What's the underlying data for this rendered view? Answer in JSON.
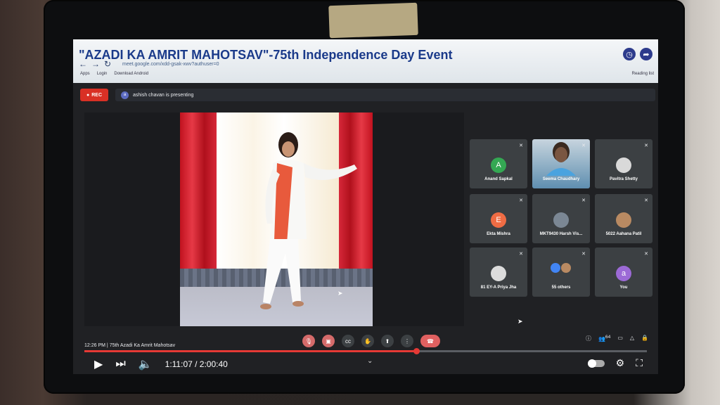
{
  "browser": {
    "tab_title": "\"AZADI KA AMRIT MAHOTSAV\"-75th Independence Day Event",
    "url": "meet.google.com/xdd-gsak-xwv?authuser=0",
    "bookmarks": [
      "Apps",
      "Login",
      "Download Android"
    ],
    "reading_list": "Reading list"
  },
  "meet": {
    "rec_label": "REC",
    "presenter_initial": "a",
    "presenting_text": "ashish chavan is presenting",
    "participants": [
      {
        "name": "Anand Sapkal",
        "initial": "A",
        "color": "#34a853",
        "type": "avatar"
      },
      {
        "name": "Seema Chaudhary",
        "initial": "",
        "color": "#5f8fb0",
        "type": "video"
      },
      {
        "name": "Pavitra Shetty",
        "initial": "",
        "color": "#d9d9d9",
        "type": "photo"
      },
      {
        "name": "Ekta Mishra",
        "initial": "E",
        "color": "#ef6c44",
        "type": "avatar"
      },
      {
        "name": "MKT9430 Harsh Vis...",
        "initial": "",
        "color": "#7b8794",
        "type": "photo"
      },
      {
        "name": "5022 Aahana Patil",
        "initial": "",
        "color": "#b98a62",
        "type": "photo"
      },
      {
        "name": "81 EY-A Priya Jha",
        "initial": "",
        "color": "#dcdcdc",
        "type": "photo"
      },
      {
        "name": "55 others",
        "initial": "",
        "color": "#4285f4",
        "type": "others"
      },
      {
        "name": "You",
        "initial": "a",
        "color": "#9c6ad6",
        "type": "avatar"
      }
    ],
    "clock_time": "12:26 PM",
    "meeting_name": "75th Azadi Ka Amrit Mahotsav",
    "participant_count": "64"
  },
  "player": {
    "current_time": "1:11:07",
    "duration": "2:00:40",
    "time_display": "1:11:07 / 2:00:40",
    "progress_fraction": 0.59
  }
}
